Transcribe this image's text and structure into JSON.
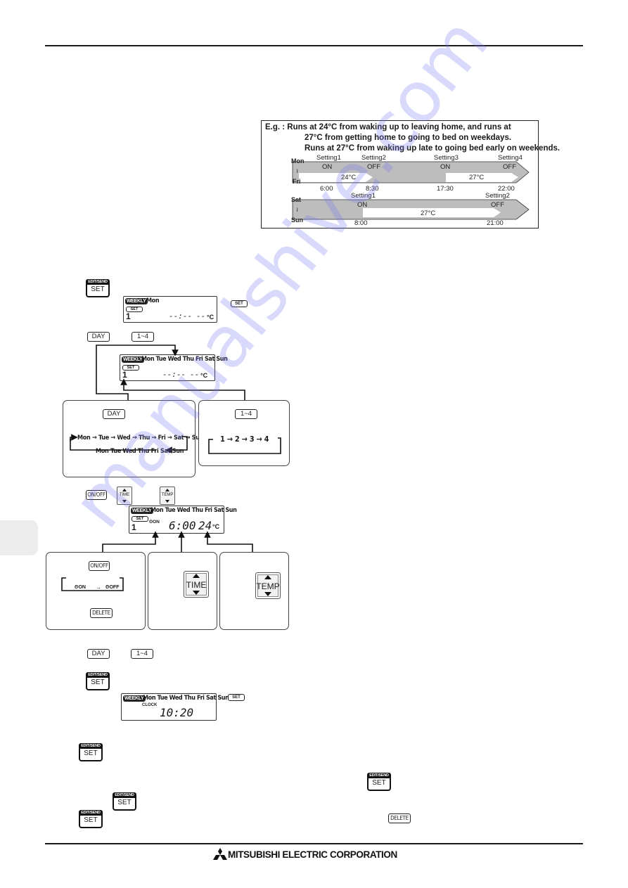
{
  "example": {
    "lines": [
      "E.g. : Runs at 24°C from waking up to leaving home, and runs at",
      "27°C from getting home to going to bed on weekdays.",
      "Runs at 27°C from waking up late to going bed early on weekends."
    ],
    "weekday": {
      "days": [
        "Mon",
        "≀",
        "Fri"
      ],
      "settings": [
        "Setting1",
        "Setting2",
        "Setting3",
        "Setting4"
      ],
      "states": [
        "ON",
        "OFF",
        "ON",
        "OFF"
      ],
      "times": [
        "6:00",
        "8:30",
        "17:30",
        "22:00"
      ],
      "temps": [
        "24°C",
        "27°C"
      ]
    },
    "weekend": {
      "days": [
        "Sat",
        "≀",
        "Sun"
      ],
      "settings": [
        "Setting1",
        "Setting2"
      ],
      "states": [
        "ON",
        "OFF"
      ],
      "times": [
        "8:00",
        "21:00"
      ],
      "temps": [
        "27°C"
      ]
    }
  },
  "keys": {
    "set_top": "EDIT/SEND",
    "set": "SET",
    "day": "DAY",
    "range": "1~4",
    "onoff": "ON/OFF",
    "time": "TIME",
    "temp": "TEMP",
    "delete": "DELETE",
    "mini_set": "SET"
  },
  "lcd1": {
    "mode": "WEEKLY",
    "days": "Mon",
    "set": "SET",
    "number": "1",
    "time": "--:--",
    "temp": "--",
    "unit": "°C"
  },
  "lcd2": {
    "mode": "WEEKLY",
    "days": "Mon Tue Wed Thu Fri Sat Sun",
    "set": "SET",
    "number": "1",
    "time": "--:--",
    "temp": "--",
    "unit": "°C"
  },
  "lcd3": {
    "mode": "WEEKLY",
    "days": "Mon Tue Wed Thu Fri Sat Sun",
    "set": "SET",
    "number": "1",
    "timer": "⏲ON",
    "time": "6:00",
    "temp": "24",
    "unit": "°C"
  },
  "lcd4": {
    "mode": "WEEKLY",
    "days": "Mon Tue Wed Thu Fri Sat Sun",
    "clock_label": "CLOCK",
    "time": "10:20"
  },
  "day_panel": {
    "cycle": "Mon → Tue → Wed → Thu → Fri → Sat → Sun",
    "return": "Mon Tue Wed Thu Fri Sat Sun"
  },
  "range_panel": {
    "cycle": "1  →  2  →  3  →  4"
  },
  "onoff_panel": {
    "on": "⏲ON",
    "off": "⏲OFF"
  },
  "footer": {
    "brand": "MITSUBISHI ELECTRIC CORPORATION"
  },
  "watermark": "manualshive.com"
}
